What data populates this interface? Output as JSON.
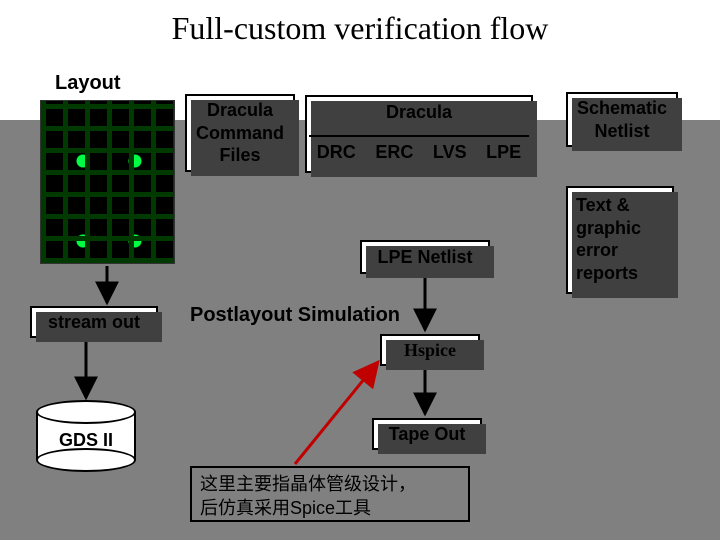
{
  "title": "Full-custom verification flow",
  "labels": {
    "layout": "Layout",
    "postlayout_sim": "Postlayout Simulation"
  },
  "boxes": {
    "dracula_cmd": "Dracula\nCommand\nFiles",
    "dracula_title": "Dracula",
    "checks": [
      "DRC",
      "ERC",
      "LVS",
      "LPE"
    ],
    "schematic_netlist": "Schematic\nNetlist",
    "lpe_netlist": "LPE Netlist",
    "error_reports": "Text &\ngraphic\nerror\nreports",
    "stream_out": "stream out",
    "hspice": "Hspice",
    "tape_out": "Tape Out",
    "gds2": "GDS II"
  },
  "annotation": {
    "line1": "这里主要指晶体管级设计，",
    "line2": "后仿真采用Spice工具"
  }
}
